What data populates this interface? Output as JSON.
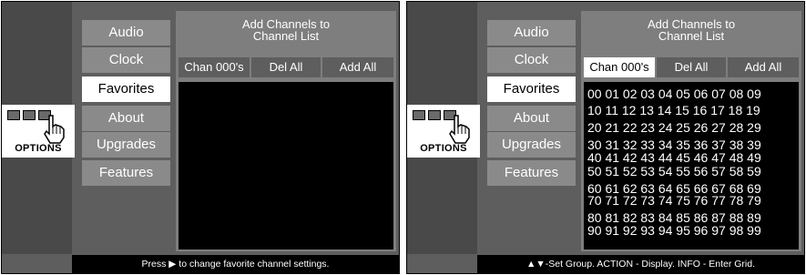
{
  "screens": [
    {
      "menu": [
        "Audio",
        "Clock",
        "Favorites",
        "About",
        "Upgrades",
        "Features"
      ],
      "active_menu": "Favorites",
      "panel_title": "Add Channels to\nChannel List",
      "tabs": [
        "Chan 000's",
        "Del All",
        "Add All"
      ],
      "active_tab": "",
      "grid_rows": [],
      "options_label": "OPTIONS",
      "status_before": "Press",
      "status_symbol": "▶",
      "status_after": "to change favorite channel settings."
    },
    {
      "menu": [
        "Audio",
        "Clock",
        "Favorites",
        "About",
        "Upgrades",
        "Features"
      ],
      "active_menu": "Favorites",
      "panel_title": "Add Channels to\nChannel List",
      "tabs": [
        "Chan 000's",
        "Del All",
        "Add All"
      ],
      "active_tab": "Chan 000's",
      "grid_rows": [
        "00 01 02 03 04 05 06 07 08 09",
        "10 11 12 13 14 15 16 17 18 19",
        "20 21 22 23 24 25 26 27 28 29",
        "30 31 32 33 34 35 36 37 38 39",
        "40 41 42 43 44 45 46 47 48 49",
        "50 51 52 53 54 55 56 57 58 59",
        "60 61 62 63 64 65 66 67 68 69",
        "70 71 72 73 74 75 76 77 78 79",
        "80 81 82 83 84 85 86 87 88 89",
        "90 91 92 93 94 95 96 97 98 99"
      ],
      "options_label": "OPTIONS",
      "status_before": "",
      "status_symbol": "▲▼",
      "status_after": "-Set Group. ACTION - Display. INFO - Enter Grid."
    }
  ],
  "colors": {
    "screen_bg": "#5e5e5e",
    "menu_bg": "#8a8a8a",
    "menu_active_bg": "#ffffff",
    "panel_bg": "#7e7e7e",
    "grid_bg": "#000000",
    "status_bg": "#000000"
  },
  "icons": {
    "options": "hand-pointer-icon"
  }
}
